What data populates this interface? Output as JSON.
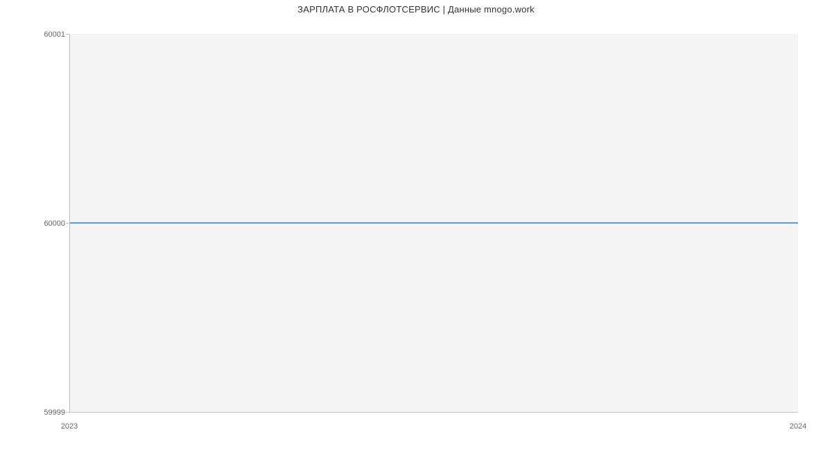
{
  "chart_data": {
    "type": "line",
    "title": "ЗАРПЛАТА В РОСФЛОТСЕРВИС | Данные mnogo.work",
    "xlabel": "",
    "ylabel": "",
    "x": [
      2023,
      2024
    ],
    "values": [
      60000,
      60000
    ],
    "ylim": [
      59999,
      60001
    ],
    "xlim": [
      2023,
      2024
    ],
    "y_ticks": [
      59999,
      60000,
      60001
    ],
    "x_ticks": [
      2023,
      2024
    ],
    "line_color": "#5b9bd5"
  },
  "labels": {
    "y_tick_0": "59999",
    "y_tick_1": "60000",
    "y_tick_2": "60001",
    "x_tick_0": "2023",
    "x_tick_1": "2024"
  }
}
